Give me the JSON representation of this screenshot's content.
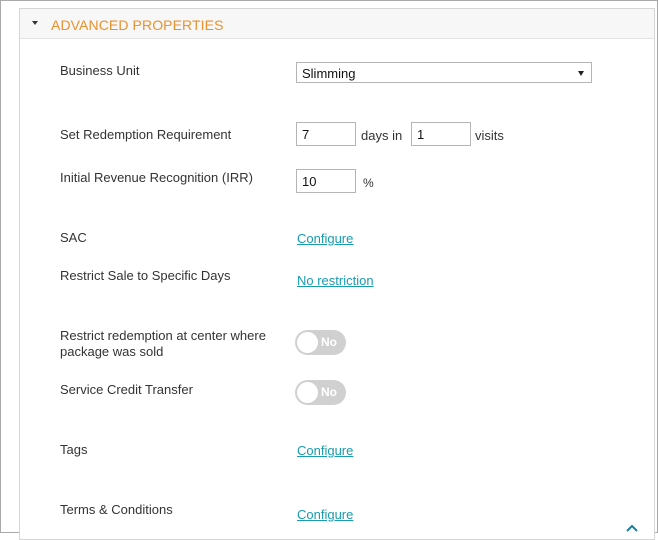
{
  "panel": {
    "title": "ADVANCED PROPERTIES"
  },
  "business_unit": {
    "label": "Business Unit",
    "selected": "Slimming"
  },
  "redemption": {
    "label": "Set Redemption Requirement",
    "days_value": "7",
    "days_in_text": "days in",
    "visits_value": "1",
    "visits_text": "visits"
  },
  "irr": {
    "label": "Initial Revenue Recognition (IRR)",
    "value": "10",
    "unit": "%"
  },
  "sac": {
    "label": "SAC",
    "link": "Configure"
  },
  "restrict_days": {
    "label": "Restrict Sale to Specific Days",
    "link": "No restriction"
  },
  "restrict_center": {
    "label_line1": "Restrict redemption at center where",
    "label_line2": "package was sold",
    "toggle": "No"
  },
  "credit_transfer": {
    "label": "Service Credit Transfer",
    "toggle": "No"
  },
  "tags": {
    "label": "Tags",
    "link": "Configure"
  },
  "terms": {
    "label": "Terms & Conditions",
    "link": "Configure"
  },
  "colors": {
    "accent": "#e8912d",
    "link": "#1a9bb0",
    "toggle_off": "#d0d0d0"
  },
  "icons": {
    "collapse": "caret-down-icon",
    "select": "dropdown-arrow-icon",
    "scroll": "scroll-up-chevron-icon"
  }
}
